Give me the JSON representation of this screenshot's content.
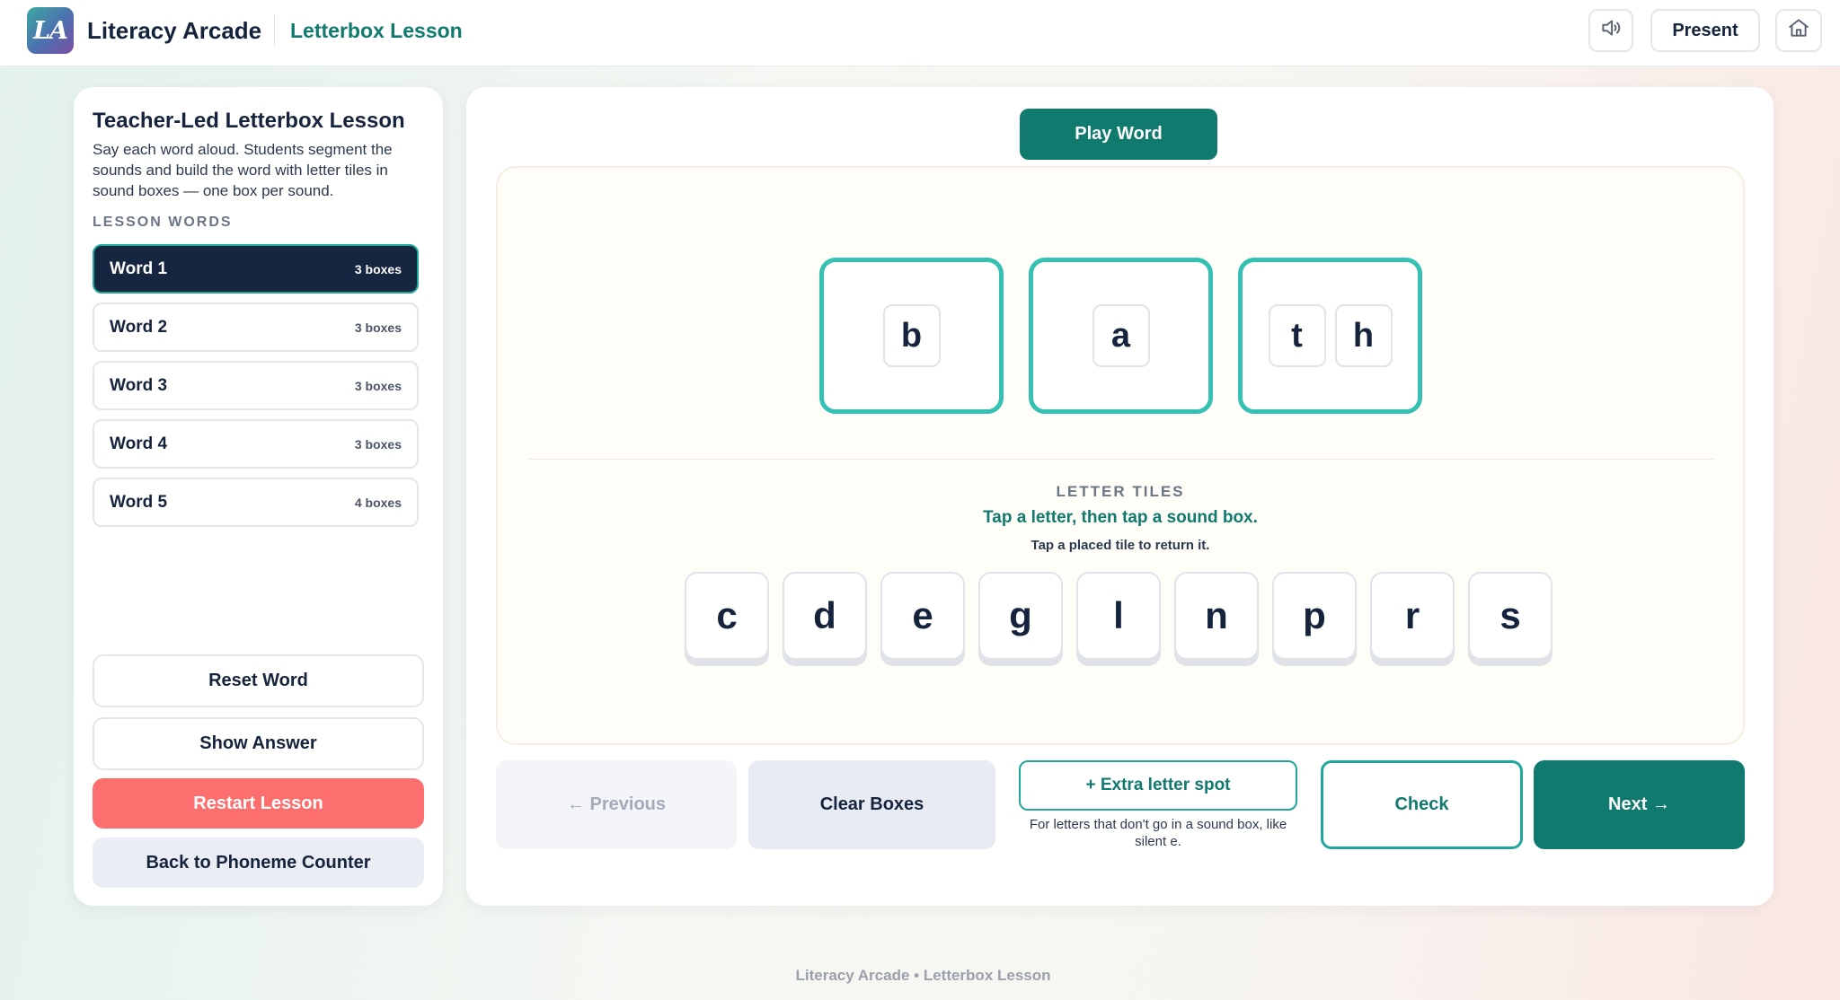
{
  "header": {
    "logo_text": "LA",
    "app_title": "Literacy Arcade",
    "lesson_title": "Letterbox Lesson",
    "present_label": "Present",
    "sound_icon": "speaker-icon",
    "home_icon": "home-icon"
  },
  "sidebar": {
    "title": "Teacher-Led Letterbox Lesson",
    "description": "Say each word aloud. Students segment the sounds and build the word with letter tiles in sound boxes — one box per sound.",
    "section_label": "LESSON WORDS",
    "words": [
      {
        "label": "Word 1",
        "boxes": "3 boxes",
        "active": true
      },
      {
        "label": "Word 2",
        "boxes": "3 boxes",
        "active": false
      },
      {
        "label": "Word 3",
        "boxes": "3 boxes",
        "active": false
      },
      {
        "label": "Word 4",
        "boxes": "3 boxes",
        "active": false
      },
      {
        "label": "Word 5",
        "boxes": "4 boxes",
        "active": false
      }
    ],
    "reset_label": "Reset Word",
    "show_answer_label": "Show Answer",
    "restart_label": "Restart Lesson",
    "back_label": "Back to Phoneme Counter"
  },
  "main": {
    "play_label": "Play Word",
    "sound_boxes": [
      {
        "letters": [
          "b"
        ]
      },
      {
        "letters": [
          "a"
        ]
      },
      {
        "letters": [
          "t",
          "h"
        ]
      }
    ],
    "tiles_heading": "LETTER TILES",
    "tiles_instruction": "Tap a letter, then tap a sound box.",
    "tiles_subtext": "Tap a placed tile to return it.",
    "letter_tiles": [
      "c",
      "d",
      "e",
      "g",
      "l",
      "n",
      "p",
      "r",
      "s"
    ],
    "previous_label": "← Previous",
    "clear_label": "Clear Boxes",
    "extra_label": "+ Extra letter spot",
    "extra_note": "For letters that don't go in a sound box, like silent e.",
    "check_label": "Check",
    "next_label": "Next →"
  },
  "footer": {
    "text": "Literacy Arcade • Letterbox Lesson"
  },
  "colors": {
    "accent": "#107a6e",
    "box_border": "#34c0b3",
    "active_word": "#172640",
    "restart": "#fd6e6e"
  }
}
